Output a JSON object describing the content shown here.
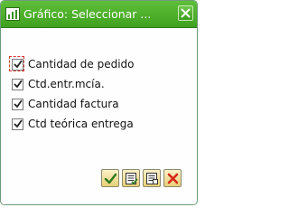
{
  "window": {
    "title": "Gráfico: Seleccionar ..."
  },
  "options": [
    {
      "label": "Cantidad de pedido",
      "checked": true,
      "focused": true
    },
    {
      "label": "Ctd.entr.mcía.",
      "checked": true,
      "focused": false
    },
    {
      "label": "Cantidad factura",
      "checked": true,
      "focused": false
    },
    {
      "label": "Ctd teórica entrega",
      "checked": true,
      "focused": false
    }
  ],
  "toolbar": {
    "buttons": [
      {
        "icon": "checkmark-icon"
      },
      {
        "icon": "select-all-icon"
      },
      {
        "icon": "deselect-all-icon"
      },
      {
        "icon": "cancel-x-icon"
      }
    ]
  },
  "colors": {
    "titlebar": "#4fb02c",
    "accent_check": "#2a7a1a",
    "cancel_red": "#d42a1a"
  }
}
